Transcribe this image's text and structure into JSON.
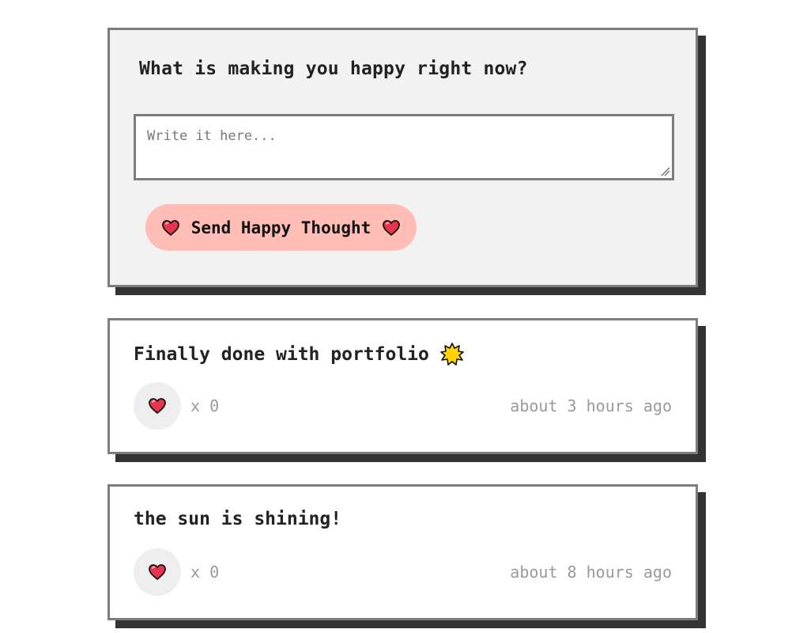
{
  "form": {
    "title": "What is making you happy right now?",
    "placeholder": "Write it here...",
    "value": "",
    "send_label": "Send Happy Thought",
    "button_icon": "heart-icon"
  },
  "thoughts": [
    {
      "message": "Finally done with portfolio",
      "emoji_icon": "sun-icon",
      "like_prefix": "x",
      "likes": "0",
      "like_text": "x 0",
      "timestamp": "about 3 hours ago"
    },
    {
      "message": "the sun is shining!",
      "like_text": "x 0",
      "likes": "0",
      "timestamp": "about 8 hours ago"
    }
  ],
  "colors": {
    "form_background": "#f2f2f2",
    "border": "#7d7d7d",
    "shadow": "#333333",
    "button": "#ffbdb5",
    "like_button": "#eeeeee",
    "muted_text": "#9a9a9a",
    "heart": "#e8344e",
    "sun": "#ffd400"
  }
}
